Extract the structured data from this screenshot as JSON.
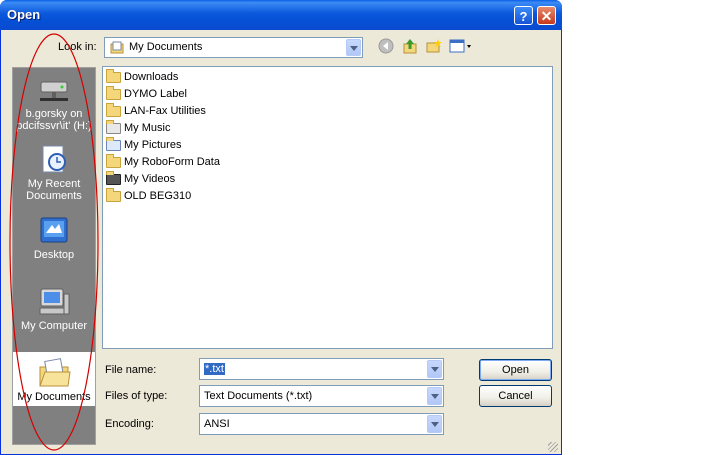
{
  "window": {
    "title": "Open",
    "help_label": "?",
    "close_label": "✕"
  },
  "lookin": {
    "label": "Look in:",
    "value": "My Documents"
  },
  "toolbar": {
    "icons": [
      "back-icon",
      "up-one-level-icon",
      "new-folder-icon",
      "views-menu-icon"
    ]
  },
  "places": [
    {
      "label": "b.gorsky on pdcifssvr\\it' (H:)",
      "icon": "network-drive-icon"
    },
    {
      "label": "My Recent Documents",
      "icon": "recent-documents-icon"
    },
    {
      "label": "Desktop",
      "icon": "desktop-icon"
    },
    {
      "label": "My Computer",
      "icon": "my-computer-icon"
    },
    {
      "label": "My Documents",
      "icon": "my-documents-icon",
      "selected": true
    }
  ],
  "files": [
    {
      "name": "Downloads",
      "icon": "folder-icon"
    },
    {
      "name": "DYMO Label",
      "icon": "folder-icon"
    },
    {
      "name": "LAN-Fax Utilities",
      "icon": "folder-icon"
    },
    {
      "name": "My Music",
      "icon": "music-folder-icon"
    },
    {
      "name": "My Pictures",
      "icon": "pictures-folder-icon"
    },
    {
      "name": "My RoboForm Data",
      "icon": "folder-icon"
    },
    {
      "name": "My Videos",
      "icon": "videos-folder-icon"
    },
    {
      "name": "OLD BEG310",
      "icon": "folder-icon"
    }
  ],
  "form": {
    "filename_label": "File name:",
    "filename_value": "*.txt",
    "filetype_label": "Files of type:",
    "filetype_value": "Text Documents (*.txt)",
    "encoding_label": "Encoding:",
    "encoding_value": "ANSI"
  },
  "buttons": {
    "open": "Open",
    "cancel": "Cancel"
  },
  "colors": {
    "titlebar": "#0a4ad0",
    "selection": "#316ac5",
    "annotation": "#d40000"
  }
}
